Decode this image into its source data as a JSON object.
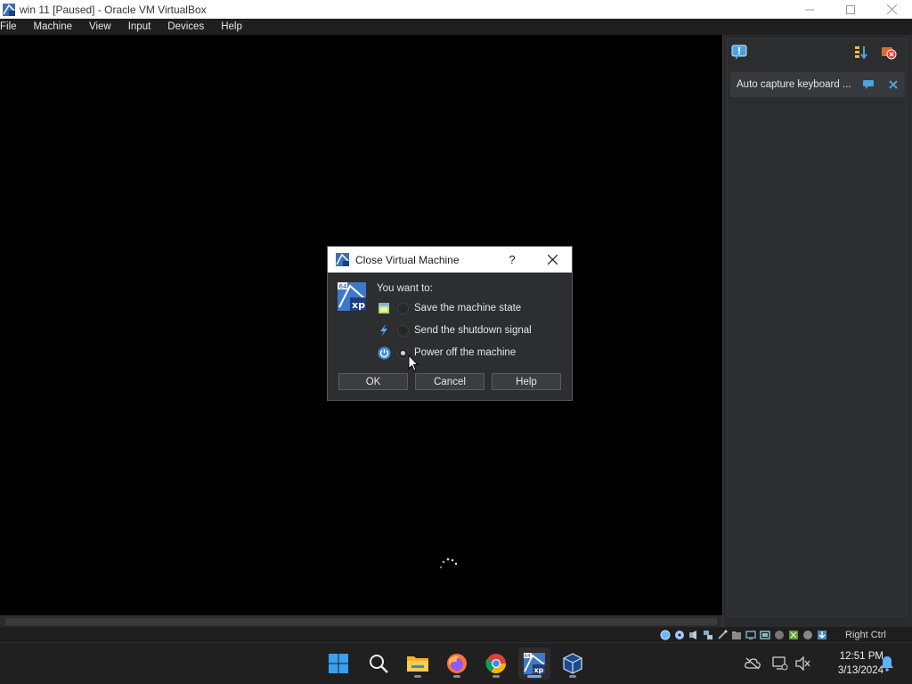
{
  "window": {
    "title": "win 11 [Paused] - Oracle VM VirtualBox",
    "controls": {
      "minimize": "—",
      "maximize": "☐",
      "close": "✕"
    }
  },
  "menu": {
    "items": [
      {
        "label": "File"
      },
      {
        "label": "Machine"
      },
      {
        "label": "View"
      },
      {
        "label": "Input"
      },
      {
        "label": "Devices"
      },
      {
        "label": "Help"
      }
    ]
  },
  "side_panel": {
    "notification": "Auto capture keyboard ..."
  },
  "dialog": {
    "title": "Close Virtual Machine",
    "help_glyph": "?",
    "prompt": "You want to:",
    "options": [
      {
        "label": "Save the machine state",
        "checked": false,
        "icon": "save-state-icon"
      },
      {
        "label": "Send the shutdown signal",
        "checked": false,
        "icon": "shutdown-signal-icon"
      },
      {
        "label": "Power off the machine",
        "checked": true,
        "icon": "power-icon"
      }
    ],
    "buttons": {
      "ok": "OK",
      "cancel": "Cancel",
      "help": "Help"
    }
  },
  "statusbar": {
    "host_key": "Right Ctrl"
  },
  "taskbar": {
    "time": "12:51 PM",
    "date": "3/13/2024",
    "apps": [
      "start-icon",
      "search-icon",
      "file-explorer-icon",
      "firefox-icon",
      "chrome-icon",
      "virtualbox-vm-icon",
      "virtualbox-icon"
    ]
  },
  "colors": {
    "accent": "#5fb2ff",
    "dialog_bg": "#2d2e30",
    "panel_bg": "#2a2b2d"
  }
}
